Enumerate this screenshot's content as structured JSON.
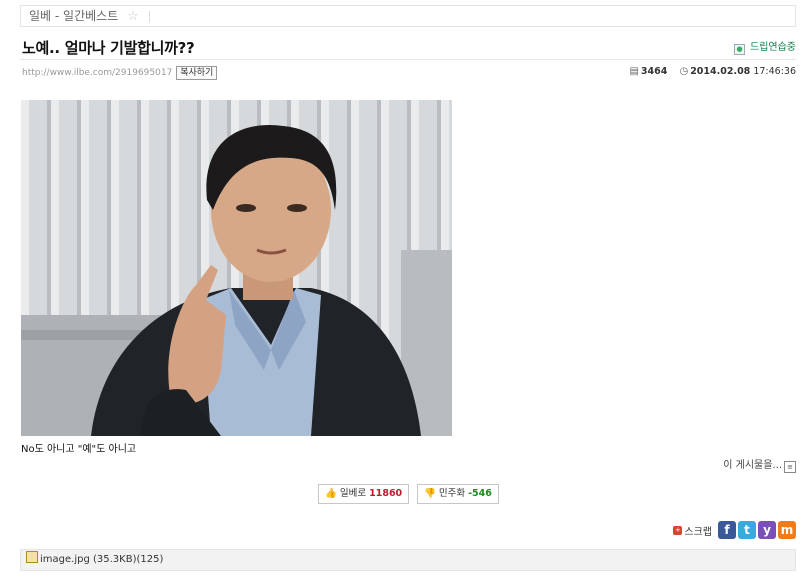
{
  "breadcrumb": {
    "text": "일베 - 일간베스트",
    "star": "☆"
  },
  "post": {
    "title": "노예.. 얼마나 기발합니까??",
    "author": "드립연습중",
    "url": "http://www.ilbe.com/2919695017",
    "copy_label": "복사하기",
    "comment_count": "3464",
    "date": "2014.02.08",
    "time": "17:46:36",
    "caption": "No도 아니고 \"예\"도 아니고",
    "more_label": "이 게시물을..."
  },
  "votes": {
    "up_label": "일베로",
    "up_count": "11860",
    "down_label": "민주화",
    "down_count": "-546"
  },
  "share": {
    "scrap_label": "스크랩",
    "buttons": [
      {
        "icon": "facebook-icon",
        "glyph": "f",
        "color": "#3b5998"
      },
      {
        "icon": "twitter-icon",
        "glyph": "t",
        "color": "#39a9e0"
      },
      {
        "icon": "yozm-icon",
        "glyph": "y",
        "color": "#7b4fb8"
      },
      {
        "icon": "me2day-icon",
        "glyph": "m",
        "color": "#f07b1a"
      }
    ]
  },
  "attachment": {
    "text": "image.jpg (35.3KB)(125)"
  }
}
